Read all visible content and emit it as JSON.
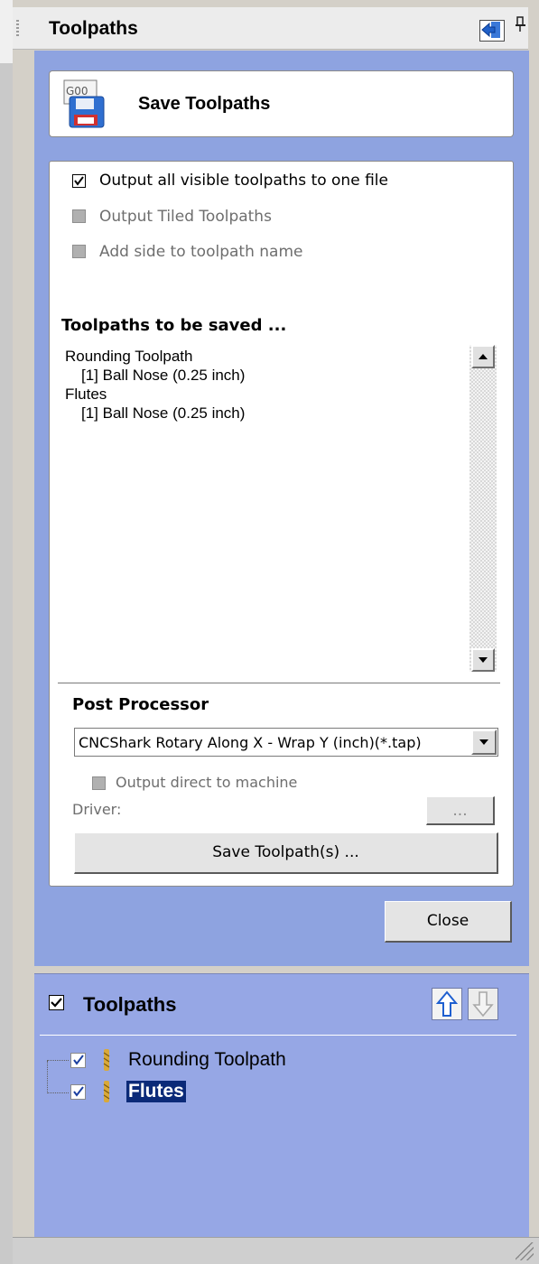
{
  "window": {
    "title": "Toolpaths"
  },
  "save_panel": {
    "header_title": "Save Toolpaths",
    "icon_text": "G00"
  },
  "options": {
    "output_all_visible": {
      "label": "Output all visible toolpaths to one file",
      "checked": true,
      "enabled": true
    },
    "output_tiled": {
      "label": "Output Tiled Toolpaths",
      "checked": false,
      "enabled": false
    },
    "add_side": {
      "label": "Add side to toolpath name",
      "checked": false,
      "enabled": false
    }
  },
  "toolpaths_to_save": {
    "heading": "Toolpaths to be saved ...",
    "items": [
      {
        "name": "Rounding Toolpath",
        "tool": "[1] Ball Nose (0.25 inch)"
      },
      {
        "name": "Flutes",
        "tool": "[1] Ball Nose (0.25 inch)"
      }
    ]
  },
  "post_processor": {
    "heading": "Post Processor",
    "selected": "CNCShark Rotary Along X - Wrap Y (inch)(*.tap)",
    "output_direct": {
      "label": "Output direct to machine",
      "checked": false,
      "enabled": false
    },
    "driver_label": "Driver:",
    "browse_label": "...",
    "save_button": "Save Toolpath(s) ..."
  },
  "close_button": "Close",
  "tree": {
    "title": "Toolpaths",
    "all_checked": true,
    "items": [
      {
        "label": "Rounding Toolpath",
        "checked": true,
        "selected": false
      },
      {
        "label": "Flutes",
        "checked": true,
        "selected": true
      }
    ]
  },
  "colors": {
    "panel_blue": "#8ea3e0",
    "tree_blue": "#96a7e5",
    "selection": "#0b2a78",
    "arrow_blue": "#1e5fd0"
  },
  "icons": [
    "grip-icon",
    "dock-icon",
    "pin-icon",
    "floppy-disk-icon",
    "move-up-icon",
    "move-down-icon",
    "drill-bit-icon",
    "size-grip-icon"
  ]
}
